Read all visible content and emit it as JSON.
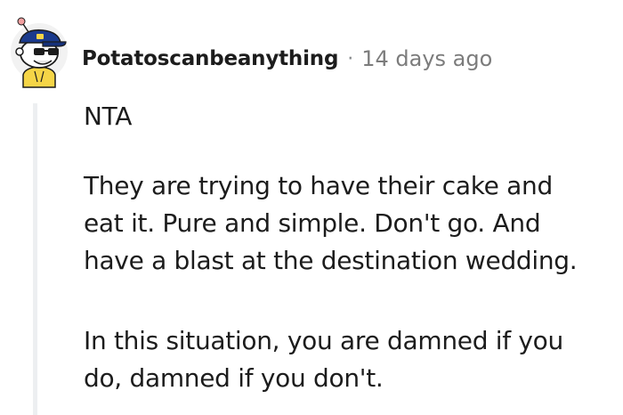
{
  "comment": {
    "username": "Potatoscanbeanything",
    "separator": "·",
    "timestamp": "14 days ago",
    "paragraphs": [
      {
        "lines": [
          "NTA"
        ]
      },
      {
        "lines": [
          "They are trying to have their cake and",
          "eat it. Pure and simple. Don't go. And",
          "have a blast at the destination wedding."
        ]
      },
      {
        "lines": [
          "In this situation, you are damned if you",
          "do, damned if you don't."
        ]
      }
    ],
    "avatar_icon": "snoo-avatar-with-cap-and-sunglasses-icon"
  },
  "colors": {
    "text": "#1c1c1c",
    "meta": "#7c7c7c",
    "thread_line": "#edeff1",
    "avatar_cap": "#1a3a8c",
    "avatar_face": "#ffffff",
    "avatar_body": "#f5d547"
  }
}
